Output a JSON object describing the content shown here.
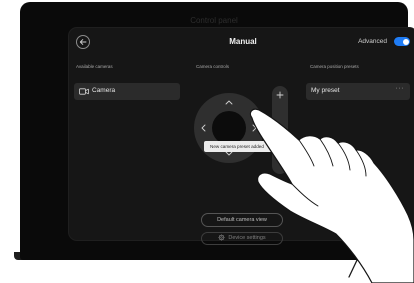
{
  "device": {
    "header_title": "Control panel"
  },
  "panel": {
    "back_icon": "arrow-left-icon",
    "title": "Manual",
    "advanced": {
      "label": "Advanced",
      "enabled": true,
      "toggle_color": "#1f7cf5"
    }
  },
  "sections": {
    "cameras": {
      "label": "Available cameras",
      "items": [
        {
          "label": "Camera",
          "icon": "camera-icon"
        }
      ]
    },
    "controls": {
      "label": "Camera controls",
      "dpad_icons": [
        "chevron-up-icon",
        "chevron-down-icon",
        "chevron-left-icon",
        "chevron-right-icon"
      ],
      "zoom_in_icon": "plus-icon"
    },
    "presets": {
      "label": "Camera position presets",
      "items": [
        {
          "label": "My preset",
          "more_icon": "more-icon"
        }
      ]
    }
  },
  "tooltip": {
    "text": "New camera preset added"
  },
  "buttons": {
    "default_view": "Default camera view",
    "device_settings": "Device settings"
  },
  "colors": {
    "screen_background": "#0a0a0a",
    "panel_background": "#161616",
    "item_background": "#2b2b2b",
    "accent": "#1f7cf5"
  }
}
